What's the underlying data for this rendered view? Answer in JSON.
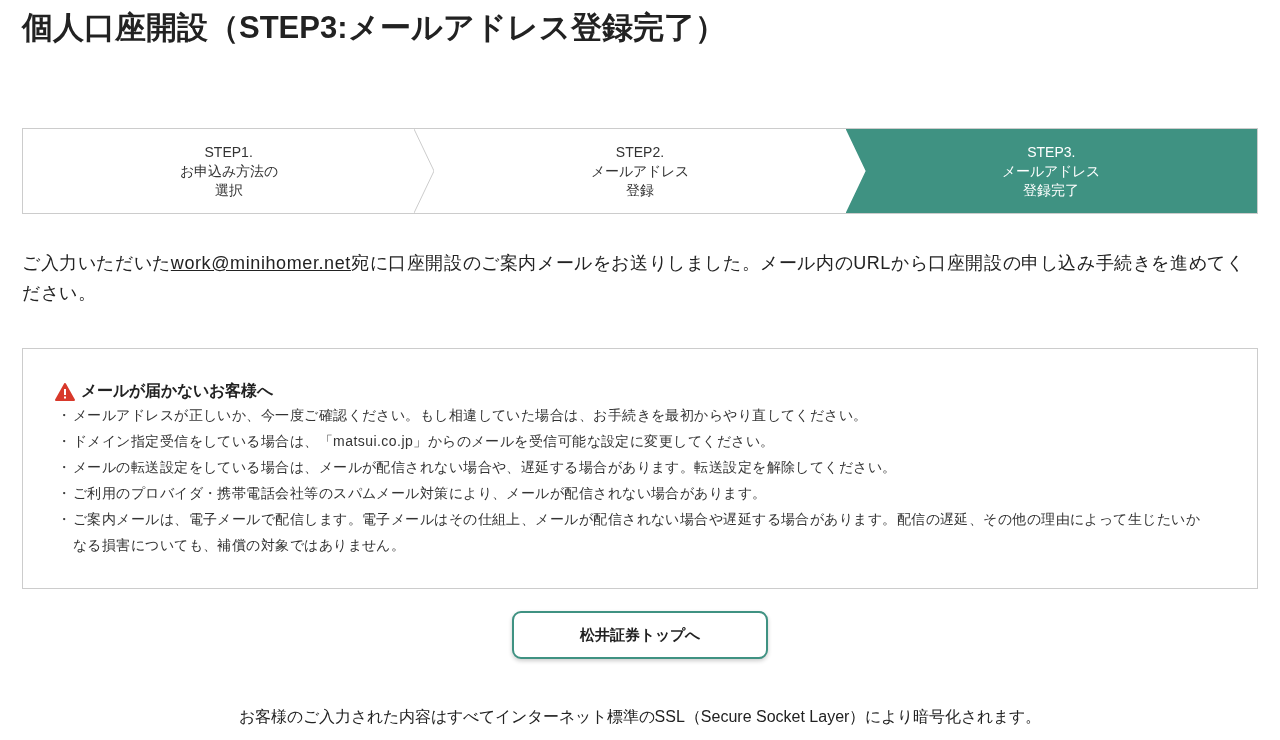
{
  "page_title": "個人口座開設（STEP3:メールアドレス登録完了）",
  "steps": [
    {
      "lines": [
        "STEP1.",
        "お申込み方法の",
        "選択"
      ],
      "selected": false
    },
    {
      "lines": [
        "STEP2.",
        "メールアドレス",
        "登録"
      ],
      "selected": false
    },
    {
      "lines": [
        "STEP3.",
        "メールアドレス",
        "登録完了"
      ],
      "selected": true
    }
  ],
  "message": {
    "before": "ご入力いただいた",
    "link": "work@minihomer.net",
    "after": "宛に口座開設のご案内メールをお送りしました。メール内のURLから口座開設の申し込み手続きを進めてください。"
  },
  "notice": {
    "title": "メールが届かないお客様へ",
    "items": [
      {
        "bullet": "・",
        "text": "メールアドレスが正しいか、今一度ご確認ください。もし相違していた場合は、お手続きを最初からやり直してください。"
      },
      {
        "bullet": "・",
        "text": "ドメイン指定受信をしている場合は、「matsui.co.jp」からのメールを受信可能な設定に変更してください。"
      },
      {
        "bullet": "・",
        "text": "メールの転送設定をしている場合は、メールが配信されない場合や、遅延する場合があります。転送設定を解除してください。"
      },
      {
        "bullet": "・",
        "text": "ご利用のプロバイダ・携帯電話会社等のスパムメール対策により、メールが配信されない場合があります。"
      },
      {
        "bullet": "・",
        "text": "ご案内メールは、電子メールで配信します。電子メールはその仕組上、メールが配信されない場合や遅延する場合があります。配信の遅延、その他の理由によって生じたいかなる損害についても、補償の対象ではありません。"
      }
    ]
  },
  "top_button": "松井証券トップへ",
  "footer_note": "お客様のご入力された内容はすべてインターネット標準のSSL（Secure Socket Layer）により暗号化されます。"
}
